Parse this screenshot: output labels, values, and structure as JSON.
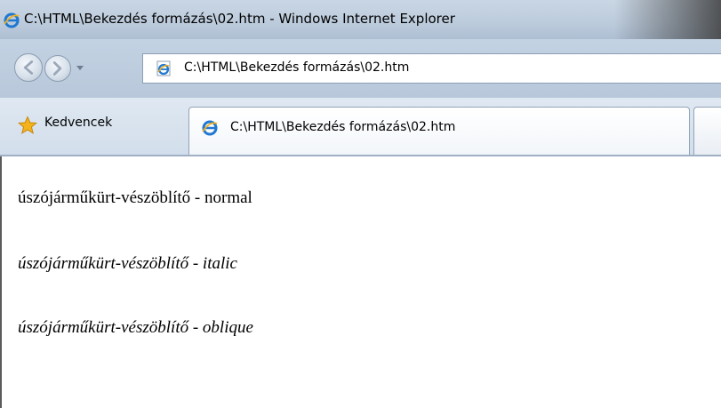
{
  "window": {
    "title": "C:\\HTML\\Bekezdés formázás\\02.htm - Windows Internet Explorer",
    "icon": "ie-icon"
  },
  "navigation": {
    "back_icon": "back-arrow-icon",
    "forward_icon": "forward-arrow-icon",
    "address": "C:\\HTML\\Bekezdés formázás\\02.htm"
  },
  "favorites": {
    "label": "Kedvencek",
    "icon": "star-icon"
  },
  "tabs": [
    {
      "label": "C:\\HTML\\Bekezdés formázás\\02.htm",
      "active": true
    }
  ],
  "content": {
    "paragraphs": [
      {
        "text": "úszójárműkürt-vészöblítő - normal",
        "style": "normal"
      },
      {
        "text": "úszójárműkürt-vészöblítő - italic",
        "style": "italic"
      },
      {
        "text": "úszójárműkürt-vészöblítő - oblique",
        "style": "oblique"
      }
    ]
  },
  "colors": {
    "chrome": "#c3d2e3",
    "text": "#000000",
    "background": "#ffffff"
  }
}
